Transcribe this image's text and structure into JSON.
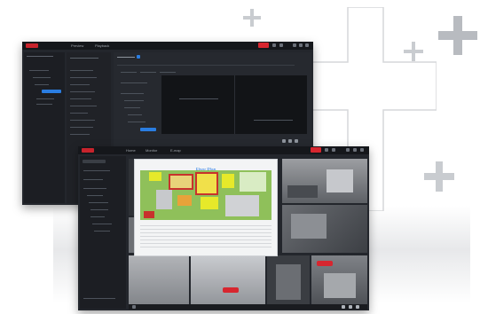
{
  "back_window": {
    "toolbar_tabs": [
      "Preview",
      "Playback"
    ]
  },
  "front_window": {
    "toolbar_tabs": [
      "Home",
      "Monitor",
      "E-map"
    ],
    "map_title": "Floor Plan"
  },
  "colors": {
    "accent": "#2a7de1",
    "brand": "#c8232c",
    "panel": "#23262c",
    "video_dark": "#3a3d42"
  },
  "icons": [
    "plus-icon",
    "plus-icon",
    "plus-icon",
    "plus-icon",
    "settings-icon",
    "fullscreen-icon",
    "layout-icon"
  ]
}
